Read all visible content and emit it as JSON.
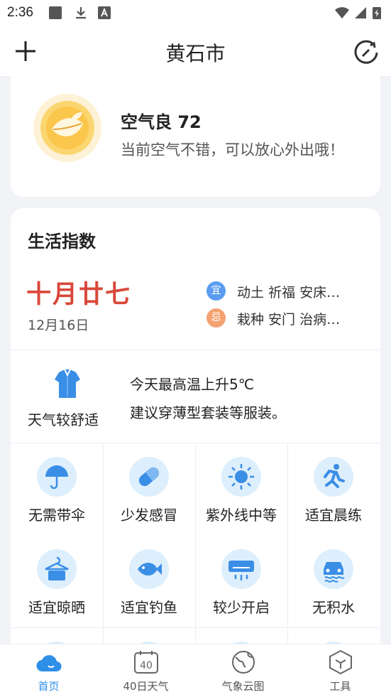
{
  "status_bar": {
    "time": "2:36"
  },
  "header": {
    "title": "黄石市"
  },
  "air": {
    "title": "空气良 72",
    "desc": "当前空气不错，可以放心外出哦！"
  },
  "life": {
    "title": "生活指数",
    "lunar_date": "十月廿七",
    "solar_date": "12月16日",
    "yi": {
      "badge": "宜",
      "text": "动土 祈福 安床…",
      "color": "#5a9cf0"
    },
    "ji": {
      "badge": "忌",
      "text": "栽种 安门 治病…",
      "color": "#f3a271"
    },
    "clothing": {
      "label": "天气较舒适",
      "line1": "今天最高温上升5℃",
      "line2": "建议穿薄型套装等服装。"
    },
    "indices": [
      {
        "label": "无需带伞",
        "icon": "umbrella-icon"
      },
      {
        "label": "少发感冒",
        "icon": "pill-icon"
      },
      {
        "label": "紫外线中等",
        "icon": "sun-icon"
      },
      {
        "label": "适宜晨练",
        "icon": "running-icon"
      },
      {
        "label": "适宜晾晒",
        "icon": "clothes-hanger-icon"
      },
      {
        "label": "适宜钓鱼",
        "icon": "fish-icon"
      },
      {
        "label": "较少开启",
        "icon": "air-conditioner-icon"
      },
      {
        "label": "无积水",
        "icon": "car-water-icon"
      }
    ]
  },
  "nav": {
    "items": [
      {
        "label": "首页",
        "icon": "cloud-icon",
        "active": true
      },
      {
        "label": "40日天气",
        "icon": "calendar-40-icon",
        "active": false
      },
      {
        "label": "气象云图",
        "icon": "globe-icon",
        "active": false
      },
      {
        "label": "工具",
        "icon": "tool-hexagon-icon",
        "active": false
      }
    ],
    "calendar_number": "40"
  },
  "colors": {
    "accent": "#2e8fe8",
    "lunar": "#d9483b",
    "icon_bg": "#ddeffc",
    "icon_fg": "#3a8ee6"
  }
}
